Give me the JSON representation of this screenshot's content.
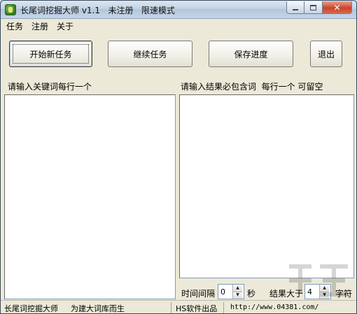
{
  "window": {
    "title": "长尾词挖掘大师 v1.1   未注册   限速模式",
    "close_glyph": "✕"
  },
  "menu": {
    "items": [
      "任务",
      "注册",
      "关于"
    ]
  },
  "toolbar": {
    "start_label": "开始新任务",
    "continue_label": "继续任务",
    "save_label": "保存进度",
    "exit_label": "退出"
  },
  "left_panel": {
    "label": "请输入关键词每行一个",
    "value": ""
  },
  "right_panel": {
    "label": "请输入结果必包含词  每行一个 可留空",
    "value": ""
  },
  "options": {
    "interval_label": "时间间隔",
    "interval_value": "0",
    "interval_unit": "秒",
    "result_label": "结果大于",
    "result_value": "4",
    "result_unit": "字符"
  },
  "statusbar": {
    "app_name": "长尾词挖掘大师",
    "slogan": "为建大词库而生",
    "publisher": "HS软件出品",
    "url": "http://www.04381.com/"
  },
  "colors": {
    "accent_close": "#c8452c",
    "window_face": "#ece9d8",
    "input_border": "#7f9db9"
  }
}
